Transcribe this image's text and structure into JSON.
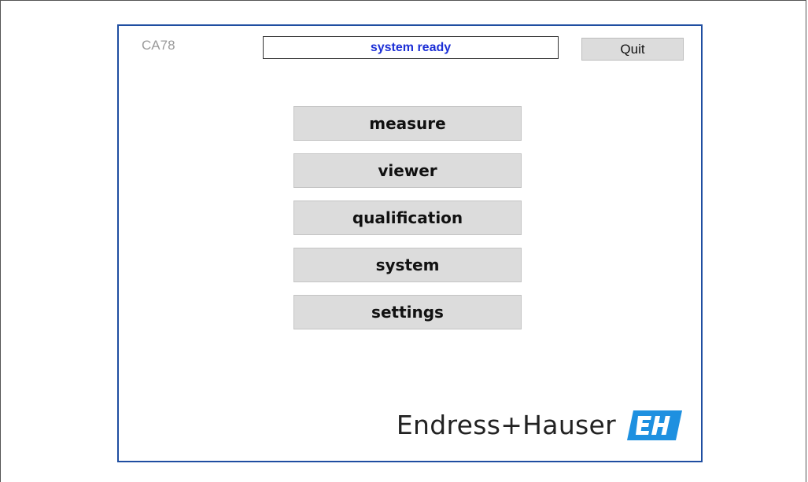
{
  "header": {
    "device_id": "CA78",
    "status": "system ready",
    "quit_label": "Quit"
  },
  "menu": {
    "items": [
      {
        "label": "measure"
      },
      {
        "label": "viewer"
      },
      {
        "label": "qualification"
      },
      {
        "label": "system"
      },
      {
        "label": "settings"
      }
    ]
  },
  "brand": {
    "name": "Endress+Hauser",
    "logo_text": "EH",
    "logo_color": "#1e90e0"
  },
  "colors": {
    "panel_border": "#1f4ea1",
    "status_text": "#1c2fd6",
    "button_bg": "#dcdcdc"
  }
}
